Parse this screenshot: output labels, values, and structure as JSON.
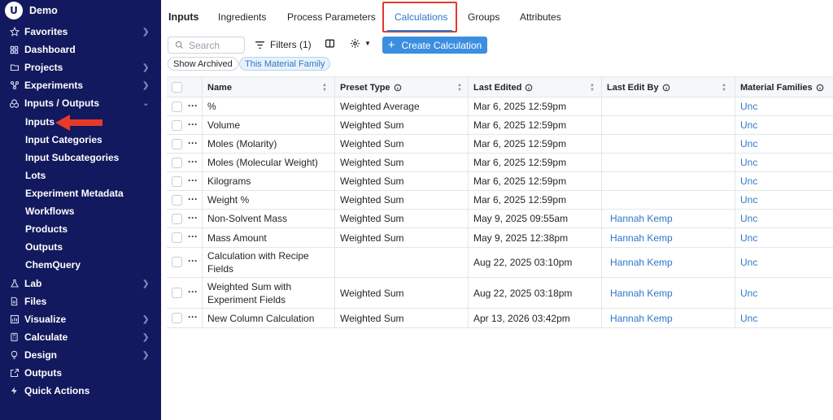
{
  "sidebar": {
    "brand": "Demo",
    "items": [
      {
        "label": "Favorites",
        "icon": "star-icon",
        "chevron": ">"
      },
      {
        "label": "Dashboard",
        "icon": "dashboard-icon",
        "chevron": ""
      },
      {
        "label": "Projects",
        "icon": "folder-icon",
        "chevron": ">"
      },
      {
        "label": "Experiments",
        "icon": "experiments-icon",
        "chevron": ">"
      },
      {
        "label": "Inputs / Outputs",
        "icon": "inputs-outputs-icon",
        "chevron": "v"
      },
      {
        "label": "Lab",
        "icon": "flask-icon",
        "chevron": ">"
      },
      {
        "label": "Files",
        "icon": "file-icon",
        "chevron": ""
      },
      {
        "label": "Visualize",
        "icon": "chart-icon",
        "chevron": ">"
      },
      {
        "label": "Calculate",
        "icon": "calculator-icon",
        "chevron": ">"
      },
      {
        "label": "Design",
        "icon": "bulb-icon",
        "chevron": ">"
      },
      {
        "label": "Outputs",
        "icon": "external-link-icon",
        "chevron": ""
      },
      {
        "label": "Quick Actions",
        "icon": "lightning-icon",
        "chevron": ""
      }
    ],
    "subitems": [
      "Inputs",
      "Input Categories",
      "Input Subcategories",
      "Lots",
      "Experiment Metadata",
      "Workflows",
      "Products",
      "Outputs",
      "ChemQuery"
    ]
  },
  "tabs": [
    "Inputs",
    "Ingredients",
    "Process Parameters",
    "Calculations",
    "Groups",
    "Attributes"
  ],
  "toolbar": {
    "search_placeholder": "Search",
    "filters_label": "Filters (1)",
    "create_label": "Create Calculation"
  },
  "chips": {
    "archived": "Show Archived",
    "family": "This Material Family"
  },
  "table": {
    "headers": [
      "Name",
      "Preset Type",
      "Last Edited",
      "Last Edit By",
      "Material Families"
    ],
    "rows": [
      {
        "name": "%",
        "preset": "Weighted Average",
        "edited": "Mar 6, 2025 12:59pm",
        "by": "",
        "family": "Unc"
      },
      {
        "name": "Volume",
        "preset": "Weighted Sum",
        "edited": "Mar 6, 2025 12:59pm",
        "by": "",
        "family": "Unc"
      },
      {
        "name": "Moles (Molarity)",
        "preset": "Weighted Sum",
        "edited": "Mar 6, 2025 12:59pm",
        "by": "",
        "family": "Unc"
      },
      {
        "name": "Moles (Molecular Weight)",
        "preset": "Weighted Sum",
        "edited": "Mar 6, 2025 12:59pm",
        "by": "",
        "family": "Unc"
      },
      {
        "name": "Kilograms",
        "preset": "Weighted Sum",
        "edited": "Mar 6, 2025 12:59pm",
        "by": "",
        "family": "Unc"
      },
      {
        "name": "Weight %",
        "preset": "Weighted Sum",
        "edited": "Mar 6, 2025 12:59pm",
        "by": "",
        "family": "Unc"
      },
      {
        "name": "Non-Solvent Mass",
        "preset": "Weighted Sum",
        "edited": "May 9, 2025 09:55am",
        "by": "Hannah Kemp",
        "family": "Unc"
      },
      {
        "name": "Mass Amount",
        "preset": "Weighted Sum",
        "edited": "May 9, 2025 12:38pm",
        "by": "Hannah Kemp",
        "family": "Unc"
      },
      {
        "name": "Calculation with Recipe Fields",
        "name_line2": "",
        "preset": "",
        "edited": "Aug 22, 2025 03:10pm",
        "by": "Hannah Kemp",
        "family": "Unc"
      },
      {
        "name": "Weighted Sum with Experiment Fields",
        "preset": "Weighted Sum",
        "edited": "Aug 22, 2025 03:18pm",
        "by": "Hannah Kemp",
        "family": "Unc"
      },
      {
        "name": "New Column Calculation",
        "preset": "Weighted Sum",
        "edited": "Apr 13, 2026 03:42pm",
        "by": "Hannah Kemp",
        "family": "Unc"
      }
    ]
  },
  "colors": {
    "sidebar_bg": "#12195e",
    "accent": "#2f76c9",
    "primary_button": "#3b8fe0",
    "highlight_red": "#e03a2c"
  }
}
